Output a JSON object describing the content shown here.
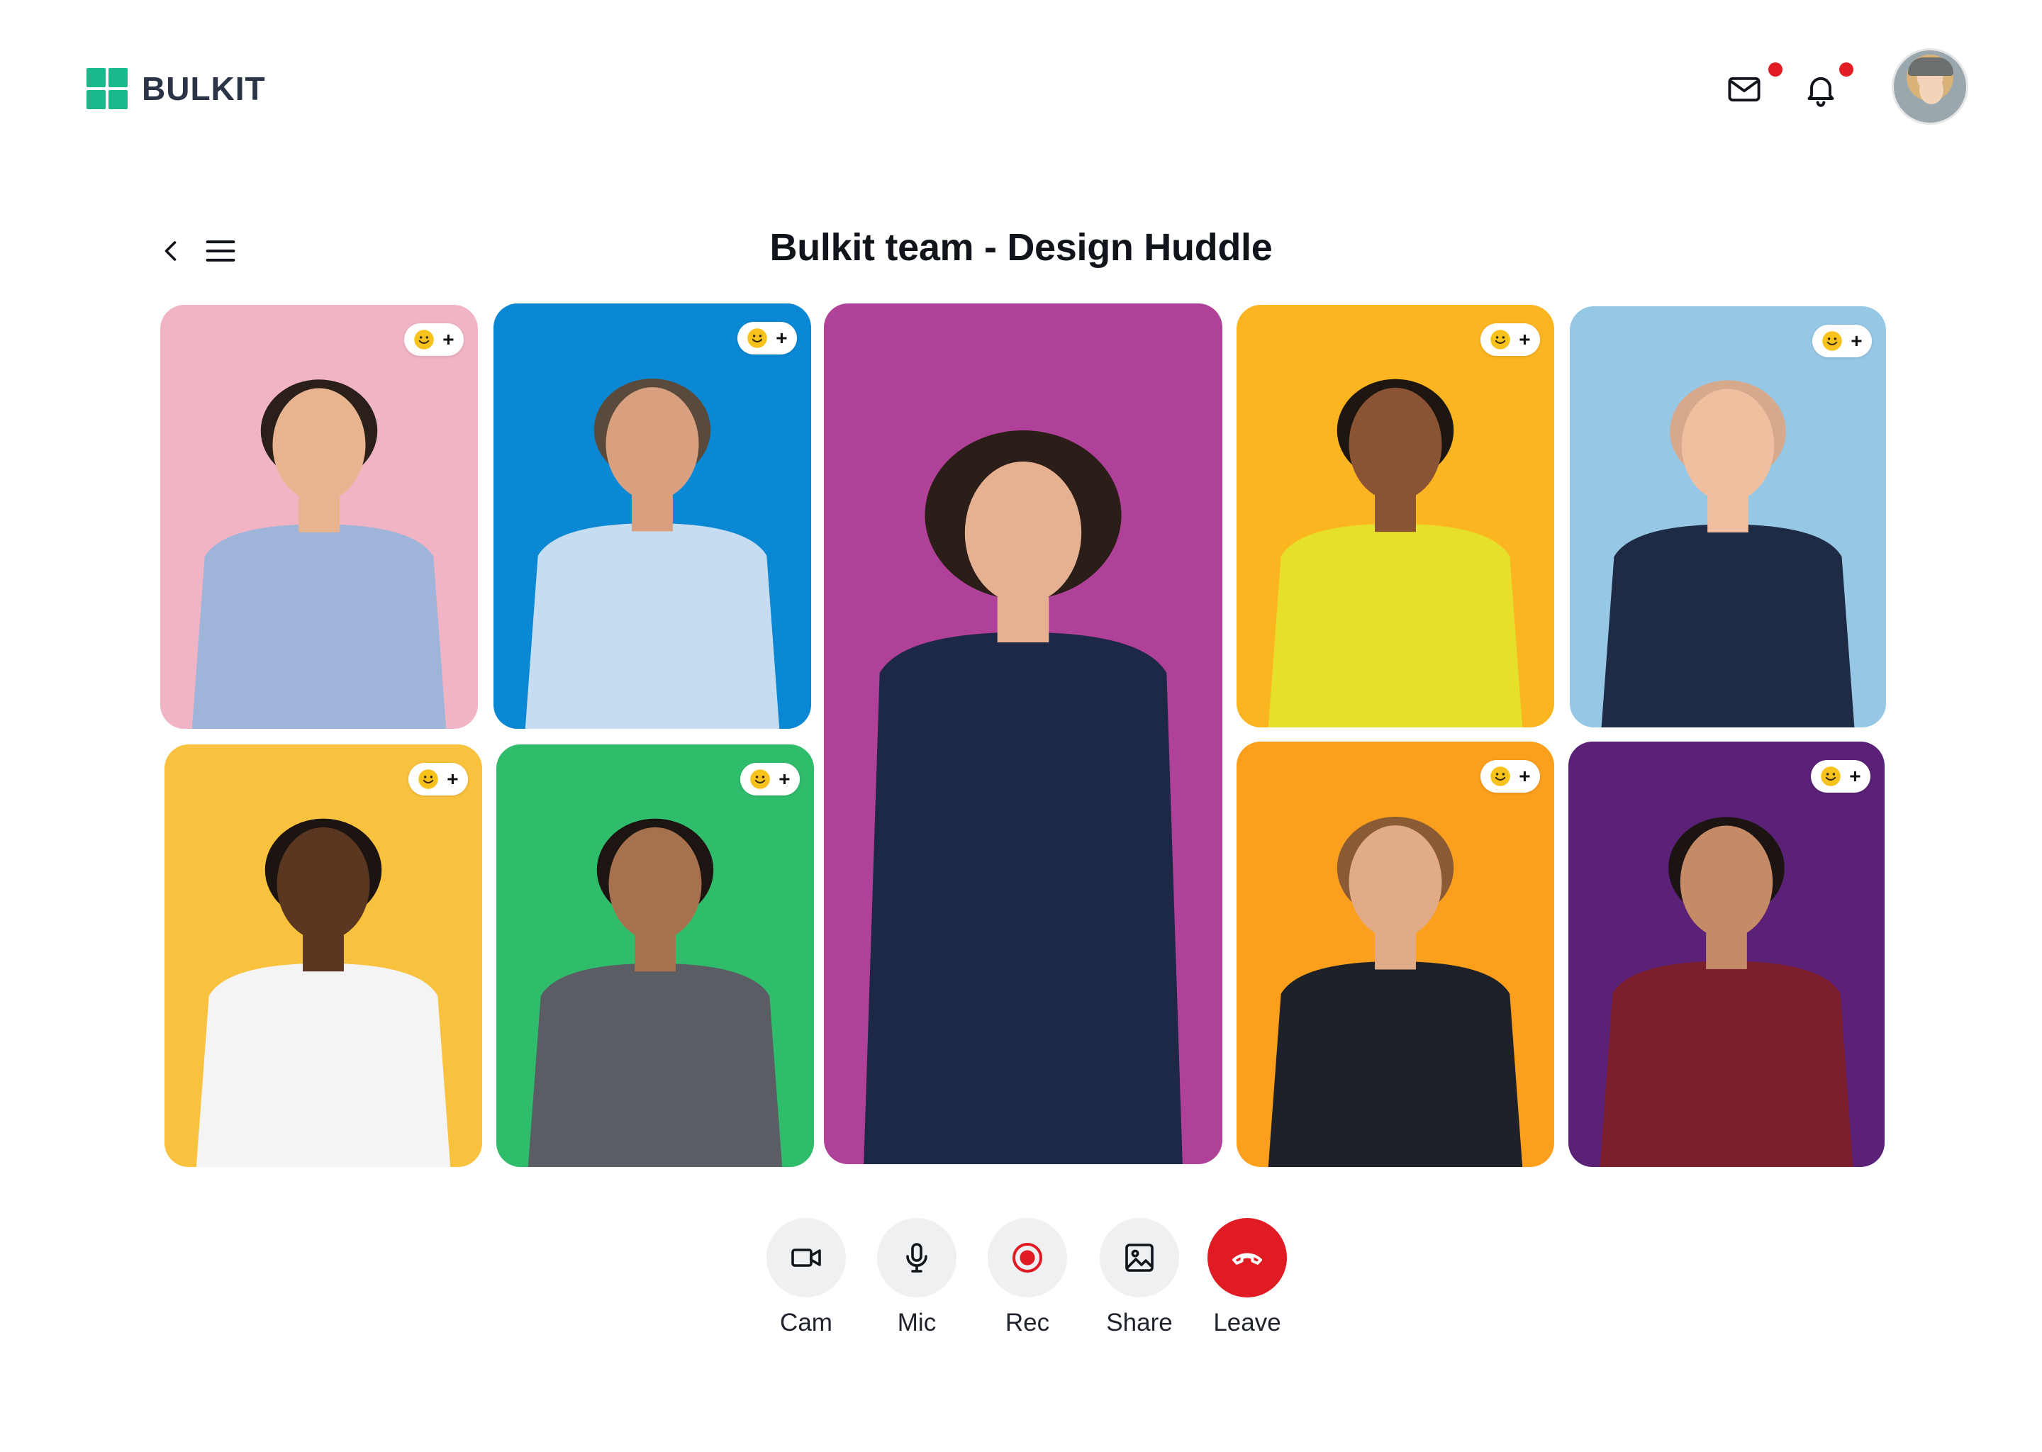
{
  "app": {
    "brand": "BULKIT",
    "brand_color": "#19b98c",
    "alert_color": "#e21b25"
  },
  "header": {
    "icons": [
      "mail-icon",
      "bell-icon"
    ],
    "mail_has_unread": true,
    "notifications_has_unread": true
  },
  "meeting": {
    "title": "Bulkit team - Design Huddle"
  },
  "participants": [
    {
      "id": "p1",
      "bg": "#f0b4c4",
      "skin": "#e8b48f",
      "hair": "#2b2019",
      "top": "#9fb4d9"
    },
    {
      "id": "p2",
      "bg": "#0b88d4",
      "skin": "#d9a07f",
      "hair": "#5a4a3c",
      "top": "#c6dcf0"
    },
    {
      "id": "p3",
      "bg": "#b04199",
      "skin": "#e6b191",
      "hair": "#2b1d17",
      "top": "#1d2746",
      "featured": true
    },
    {
      "id": "p4",
      "bg": "#fbb521",
      "skin": "#8a5434",
      "hair": "#1e1611",
      "top": "#e6e02a"
    },
    {
      "id": "p5",
      "bg": "#96c8e6",
      "skin": "#efbfa0",
      "hair": "#d7a98c",
      "top": "#1f2b44"
    },
    {
      "id": "p6",
      "bg": "#f9c23e",
      "skin": "#5b3621",
      "hair": "#1b1410",
      "top": "#f4f4f4"
    },
    {
      "id": "p7",
      "bg": "#2fbd6c",
      "skin": "#a8714d",
      "hair": "#1d1512",
      "top": "#5a5d63"
    },
    {
      "id": "p8",
      "bg": "#fb9f1c",
      "skin": "#e0ab86",
      "hair": "#8a5b34",
      "top": "#1e2228"
    },
    {
      "id": "p9",
      "bg": "#5a2176",
      "skin": "#c58b66",
      "hair": "#1c1412",
      "top": "#7d1f2c"
    }
  ],
  "controls": {
    "cam": {
      "label": "Cam",
      "icon": "video-camera-icon"
    },
    "mic": {
      "label": "Mic",
      "icon": "microphone-icon"
    },
    "rec": {
      "label": "Rec",
      "icon": "record-icon",
      "color": "#e01b23"
    },
    "share": {
      "label": "Share",
      "icon": "image-icon"
    },
    "leave": {
      "label": "Leave",
      "icon": "phone-hangup-icon",
      "color": "#e01b23"
    }
  }
}
